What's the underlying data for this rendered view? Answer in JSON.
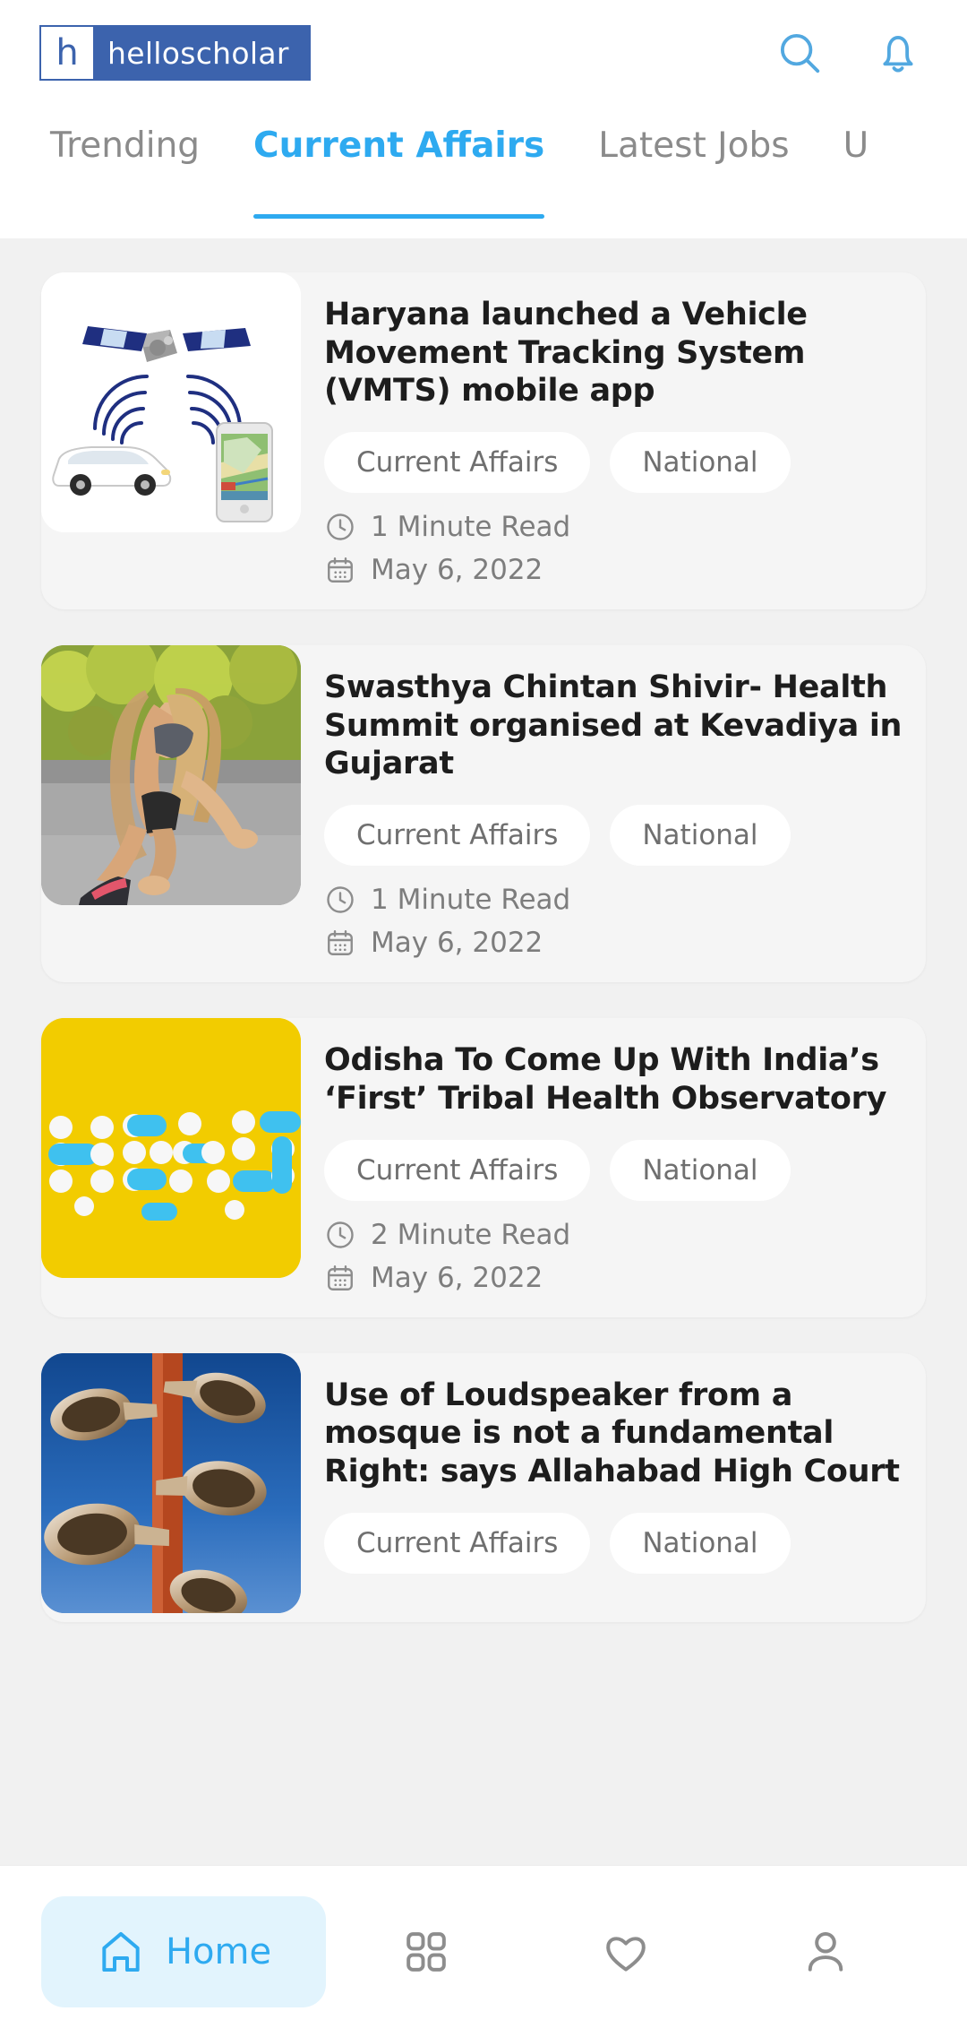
{
  "header": {
    "logo_mark": "h",
    "logo_word": "helloscholar",
    "search_icon": "search-icon",
    "bell_icon": "bell-icon"
  },
  "tabs": [
    {
      "label": "Trending",
      "active": false
    },
    {
      "label": "Current Affairs",
      "active": true
    },
    {
      "label": "Latest Jobs",
      "active": false
    },
    {
      "label": "U",
      "active": false
    }
  ],
  "feed": {
    "cards": [
      {
        "title": "Haryana launched a Vehicle Movement Tracking System (VMTS) mobile app",
        "tags": [
          "Current Affairs",
          "National"
        ],
        "read_time": "1 Minute Read",
        "date": "May 6, 2022",
        "thumb": "satellite-vehicle-tracking-image"
      },
      {
        "title": "Swasthya Chintan Shivir- Health Summit organised at Kevadiya in Gujarat",
        "tags": [
          "Current Affairs",
          "National"
        ],
        "read_time": "1 Minute Read",
        "date": "May 6, 2022",
        "thumb": "runner-on-road-image"
      },
      {
        "title": "Odisha To Come Up With India’s ‘First’ Tribal Health Observatory",
        "tags": [
          "Current Affairs",
          "National"
        ],
        "read_time": "2 Minute Read",
        "date": "May 6, 2022",
        "thumb": "health-pills-yellow-image"
      },
      {
        "title": "Use of Loudspeaker from a mosque is not a fundamental Right: says Allahabad High Court",
        "tags": [
          "Current Affairs",
          "National"
        ],
        "read_time": "",
        "date": "",
        "thumb": "loudspeakers-on-pole-image"
      }
    ],
    "meta_labels": {
      "clock_icon": "clock-icon",
      "calendar_icon": "calendar-icon"
    }
  },
  "bottom_nav": {
    "items": [
      {
        "label": "Home",
        "icon": "home-icon",
        "active": true
      },
      {
        "label": "",
        "icon": "grid-icon",
        "active": false
      },
      {
        "label": "",
        "icon": "heart-icon",
        "active": false
      },
      {
        "label": "",
        "icon": "person-icon",
        "active": false
      }
    ]
  },
  "colors": {
    "accent": "#2eaaf0",
    "logo_blue": "#3c63ad",
    "page_bg": "#f1f1f1",
    "card_bg": "#f5f5f5",
    "nav_active_bg": "#e2f4fd"
  }
}
